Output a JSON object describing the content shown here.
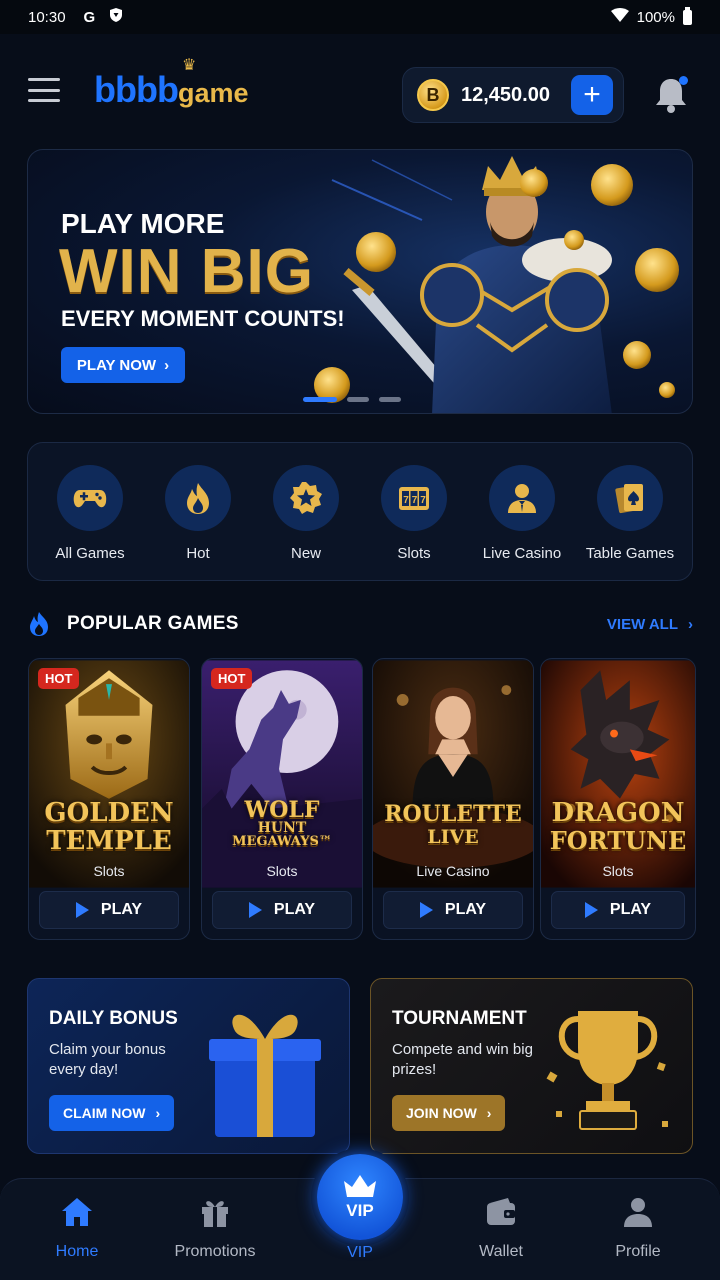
{
  "status_bar": {
    "time": "10:30",
    "g_icon": "G",
    "battery": "100%"
  },
  "header": {
    "logo_main": "bbbb",
    "logo_suffix": "game",
    "balance": "12,450.00",
    "coin_symbol": "B",
    "add_label": "+"
  },
  "hero": {
    "line1": "PLAY MORE",
    "line2": "WIN BIG",
    "line3": "EVERY MOMENT COUNTS!",
    "cta": "PLAY NOW",
    "slide_index": 1,
    "slide_count": 3
  },
  "categories": [
    {
      "label": "All Games",
      "icon": "gamepad-icon"
    },
    {
      "label": "Hot",
      "icon": "flame-icon"
    },
    {
      "label": "New",
      "icon": "star-icon"
    },
    {
      "label": "Slots",
      "icon": "slots-icon"
    },
    {
      "label": "Live Casino",
      "icon": "dealer-icon"
    },
    {
      "label": "Table Games",
      "icon": "cards-icon"
    }
  ],
  "popular": {
    "title": "POPULAR GAMES",
    "view_all": "VIEW ALL",
    "games": [
      {
        "title1": "GOLDEN",
        "title2": "TEMPLE",
        "title3": "",
        "category": "Slots",
        "badge": "HOT",
        "play": "PLAY"
      },
      {
        "title1": "WOLF",
        "title2": "HUNT",
        "title3": "MEGAWAYS™",
        "category": "Slots",
        "badge": "HOT",
        "play": "PLAY"
      },
      {
        "title1": "ROULETTE",
        "title2": "LIVE",
        "title3": "",
        "category": "Live Casino",
        "badge": "",
        "play": "PLAY"
      },
      {
        "title1": "DRAGON",
        "title2": "FORTUNE",
        "title3": "",
        "category": "Slots",
        "badge": "",
        "play": "PLAY"
      }
    ]
  },
  "promos": {
    "daily": {
      "title": "DAILY BONUS",
      "desc": "Claim your bonus every day!",
      "cta": "CLAIM NOW"
    },
    "tournament": {
      "title": "TOURNAMENT",
      "desc": "Compete and win big prizes!",
      "cta": "JOIN NOW"
    }
  },
  "nav": {
    "home": "Home",
    "promotions": "Promotions",
    "vip_badge": "VIP",
    "vip": "VIP",
    "wallet": "Wallet",
    "profile": "Profile"
  },
  "colors": {
    "accent": "#1f74ff",
    "gold": "#e2b34b",
    "background": "#070d19"
  }
}
